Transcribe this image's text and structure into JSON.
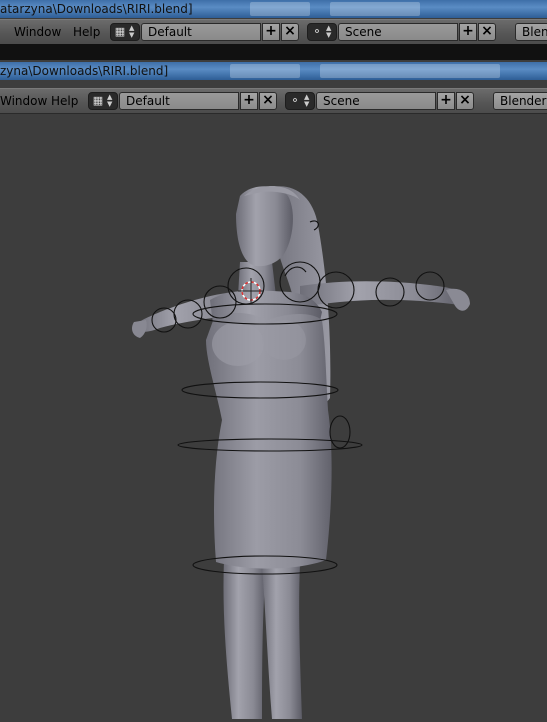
{
  "window1": {
    "title": "atarzyna\\Downloads\\RIRI.blend]",
    "menu": [
      "Window",
      "Help"
    ],
    "layout": "Default",
    "scene": "Scene",
    "engine": "Blend"
  },
  "window2": {
    "title": "zyna\\Downloads\\RIRI.blend]",
    "menu": [
      "Window",
      "Help"
    ],
    "layout": "Default",
    "scene": "Scene",
    "engine": "Blender R"
  },
  "icons": {
    "layout": "screen-layout-icon",
    "scene": "scene-icon",
    "add": "plus-icon",
    "remove": "x-icon"
  },
  "colors": {
    "header": "#555555",
    "viewport": "#3d3d3d",
    "titlebar": "#4a7cb6",
    "mesh": "#8e8e98"
  }
}
